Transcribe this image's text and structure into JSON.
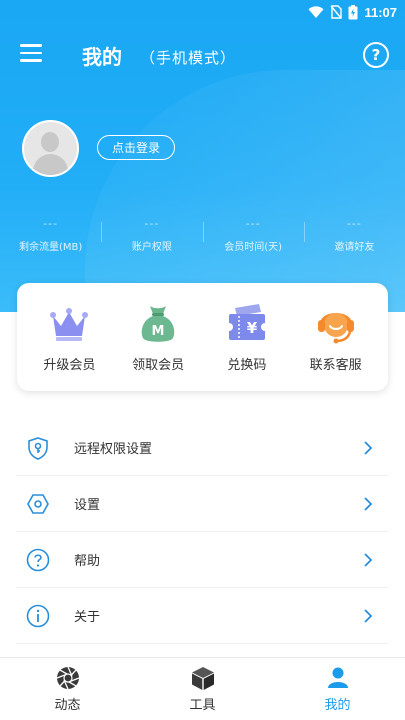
{
  "status_bar": {
    "time": "11:07"
  },
  "header": {
    "title": "我的",
    "subtitle": "（手机模式）",
    "help_symbol": "?"
  },
  "profile": {
    "login_label": "点击登录"
  },
  "stats": [
    {
      "value": "---",
      "label": "剩余流量(MB)"
    },
    {
      "value": "---",
      "label": "账户权限"
    },
    {
      "value": "---",
      "label": "会员时间(天)"
    },
    {
      "value": "---",
      "label": "邀请好友"
    }
  ],
  "quick_actions": [
    {
      "label": "升级会员",
      "icon": "crown-icon"
    },
    {
      "label": "领取会员",
      "icon": "money-bag-icon"
    },
    {
      "label": "兑换码",
      "icon": "ticket-icon"
    },
    {
      "label": "联系客服",
      "icon": "headset-icon"
    }
  ],
  "menu": [
    {
      "label": "远程权限设置",
      "icon": "shield-key-icon"
    },
    {
      "label": "设置",
      "icon": "hex-settings-icon"
    },
    {
      "label": "帮助",
      "icon": "help-circle-icon"
    },
    {
      "label": "关于",
      "icon": "info-icon"
    }
  ],
  "tabs": [
    {
      "label": "动态",
      "icon": "aperture-icon",
      "active": false
    },
    {
      "label": "工具",
      "icon": "cube-icon",
      "active": false
    },
    {
      "label": "我的",
      "icon": "person-icon",
      "active": true
    }
  ],
  "colors": {
    "primary": "#1aa7f3",
    "accent": "#1c9bea",
    "icon_blue": "#2a8fd8"
  }
}
